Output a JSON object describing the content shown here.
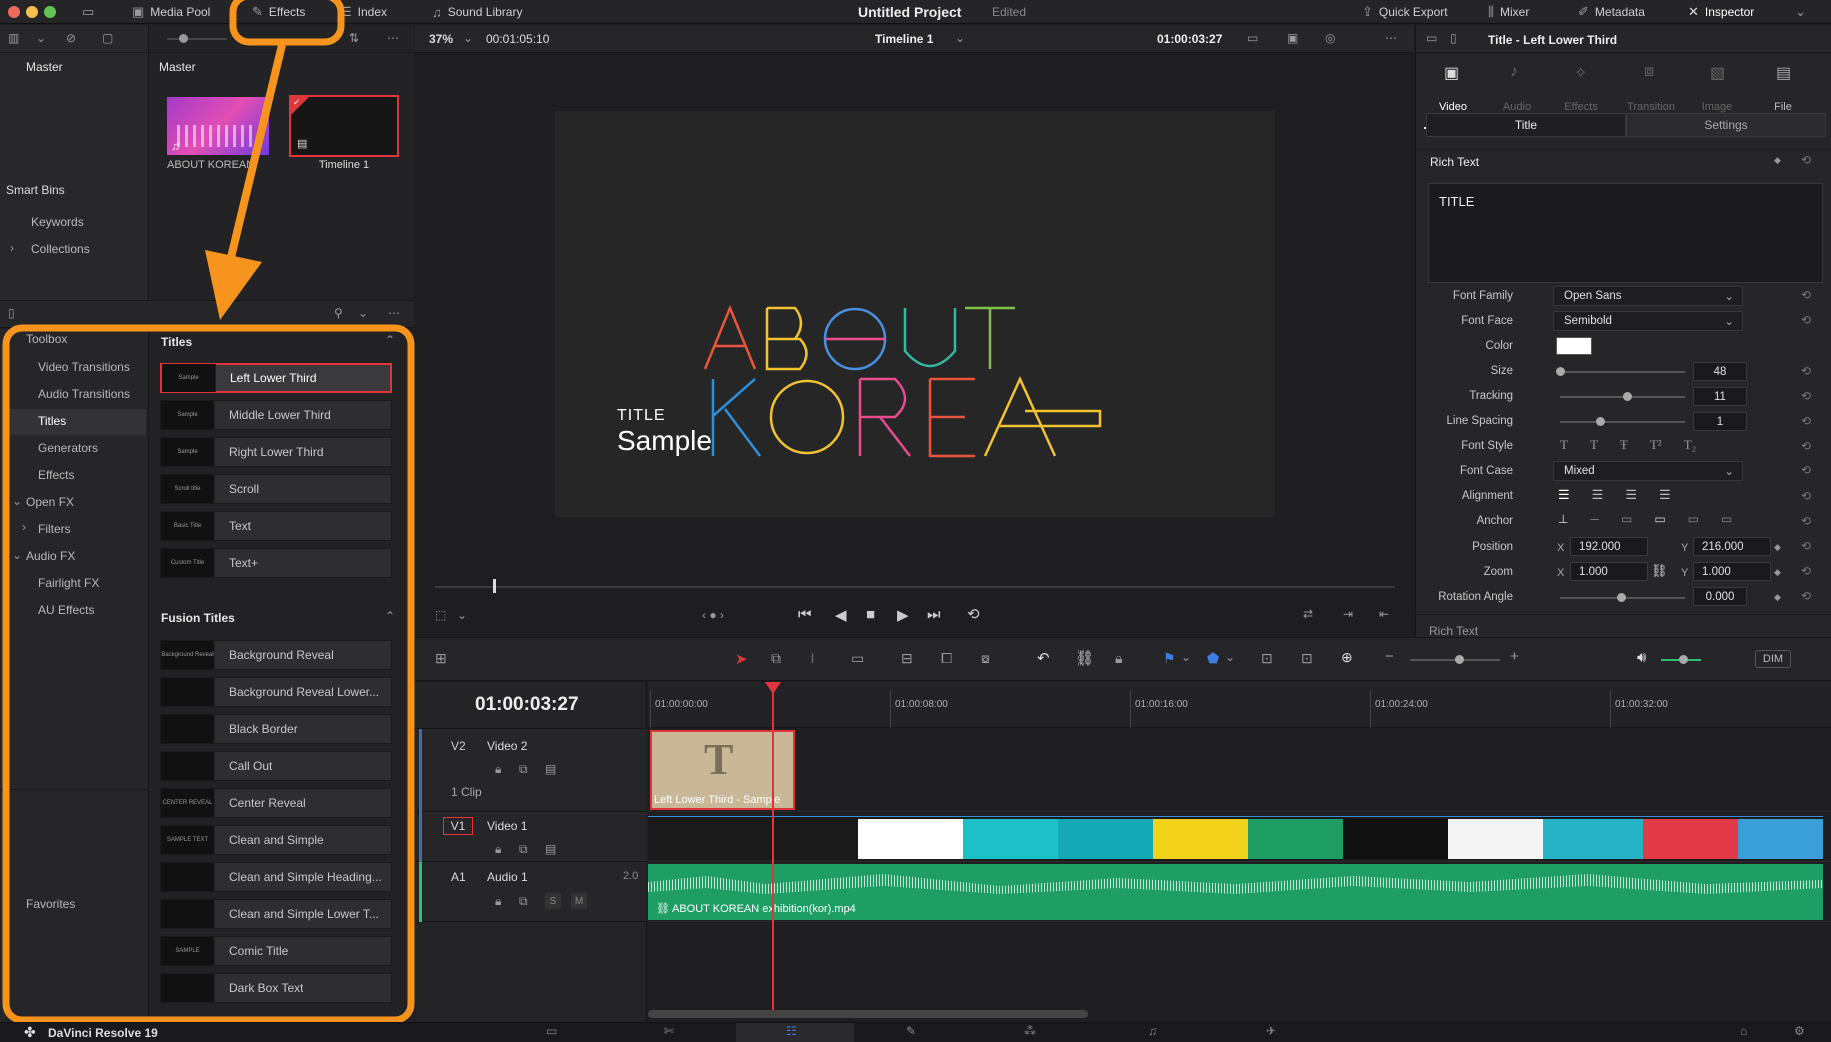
{
  "topbar": {
    "media_pool": "Media Pool",
    "effects": "Effects",
    "index": "Index",
    "sound_library": "Sound Library",
    "project_title": "Untitled Project",
    "project_status": "Edited",
    "quick_export": "Quick Export",
    "mixer": "Mixer",
    "metadata": "Metadata",
    "inspector": "Inspector"
  },
  "media_pool": {
    "bin_header": "Master",
    "grid_header": "Master",
    "smart_bins": "Smart Bins",
    "keywords": "Keywords",
    "collections": "Collections",
    "clips": [
      {
        "label": "ABOUT KOREAN"
      },
      {
        "label": "Timeline 1"
      }
    ]
  },
  "viewer": {
    "zoom": "37%",
    "source_tc": "00:01:05:10",
    "timeline_name": "Timeline 1",
    "tc": "01:00:03:27",
    "title_small": "TITLE",
    "title_big": "Sample",
    "logo_line1": "ABOUT",
    "logo_line2": "KOREA"
  },
  "toolbox": {
    "label": "Toolbox",
    "items": [
      "Video Transitions",
      "Audio Transitions",
      "Titles",
      "Generators",
      "Effects"
    ],
    "open_fx": "Open FX",
    "filters": "Filters",
    "audio_fx": "Audio FX",
    "fairlight_fx": "Fairlight FX",
    "au_effects": "AU Effects",
    "favorites": "Favorites"
  },
  "titles": {
    "header": "Titles",
    "items": [
      {
        "label": "Left Lower Third",
        "thumb": "Sample"
      },
      {
        "label": "Middle Lower Third",
        "thumb": "Sample"
      },
      {
        "label": "Right Lower Third",
        "thumb": "Sample"
      },
      {
        "label": "Scroll",
        "thumb": "Scroll title"
      },
      {
        "label": "Text",
        "thumb": "Basic Title"
      },
      {
        "label": "Text+",
        "thumb": "Custom Title"
      }
    ]
  },
  "fusion_titles": {
    "header": "Fusion Titles",
    "items": [
      {
        "label": "Background Reveal",
        "thumb": "Background Reveal"
      },
      {
        "label": "Background Reveal Lower...",
        "thumb": ""
      },
      {
        "label": "Black Border",
        "thumb": ""
      },
      {
        "label": "Call Out",
        "thumb": ""
      },
      {
        "label": "Center Reveal",
        "thumb": "CENTER REVEAL"
      },
      {
        "label": "Clean and Simple",
        "thumb": "SAMPLE TEXT"
      },
      {
        "label": "Clean and Simple Heading...",
        "thumb": ""
      },
      {
        "label": "Clean and Simple Lower T...",
        "thumb": ""
      },
      {
        "label": "Comic Title",
        "thumb": "SAMPLE"
      },
      {
        "label": "Dark Box Text",
        "thumb": ""
      }
    ]
  },
  "inspector": {
    "clip_title": "Title - Left Lower Third",
    "tabs": [
      "Video",
      "Audio",
      "Effects",
      "Transition",
      "Image",
      "File"
    ],
    "subtabs": [
      "Title",
      "Settings"
    ],
    "rich_text": "Rich Text",
    "rich_text_value": "TITLE",
    "font_family_label": "Font Family",
    "font_family": "Open Sans",
    "font_face_label": "Font Face",
    "font_face": "Semibold",
    "color_label": "Color",
    "size_label": "Size",
    "size": "48",
    "tracking_label": "Tracking",
    "tracking": "11",
    "line_spacing_label": "Line Spacing",
    "line_spacing": "1",
    "font_style_label": "Font Style",
    "font_case_label": "Font Case",
    "font_case": "Mixed",
    "alignment_label": "Alignment",
    "anchor_label": "Anchor",
    "position_label": "Position",
    "pos_x": "192.000",
    "pos_y": "216.000",
    "zoom_label": "Zoom",
    "zoom_x": "1.000",
    "zoom_y": "1.000",
    "rotation_label": "Rotation Angle",
    "rotation": "0.000",
    "next_section": "Rich Text",
    "x": "X",
    "y": "Y"
  },
  "timeline": {
    "tc": "01:00:03:27",
    "ruler": [
      "01:00:00:00",
      "01:00:08:00",
      "01:00:16:00",
      "01:00:24:00",
      "01:00:32:00"
    ],
    "v2_id": "V2",
    "v2_name": "Video 2",
    "v2_clips": "1 Clip",
    "v1_id": "V1",
    "v1_name": "Video 1",
    "a1_id": "A1",
    "a1_name": "Audio 1",
    "a1_ch": "2.0",
    "title_clip": "Left Lower Third - Sample",
    "audio_clip": "ABOUT KOREAN exhibition(kor).mp4",
    "dim": "DIM"
  },
  "bottom": {
    "app": "DaVinci Resolve 19"
  },
  "colors": {
    "orange": "#f7941d",
    "red": "#e0353a",
    "audio_green": "#1e9e64"
  }
}
